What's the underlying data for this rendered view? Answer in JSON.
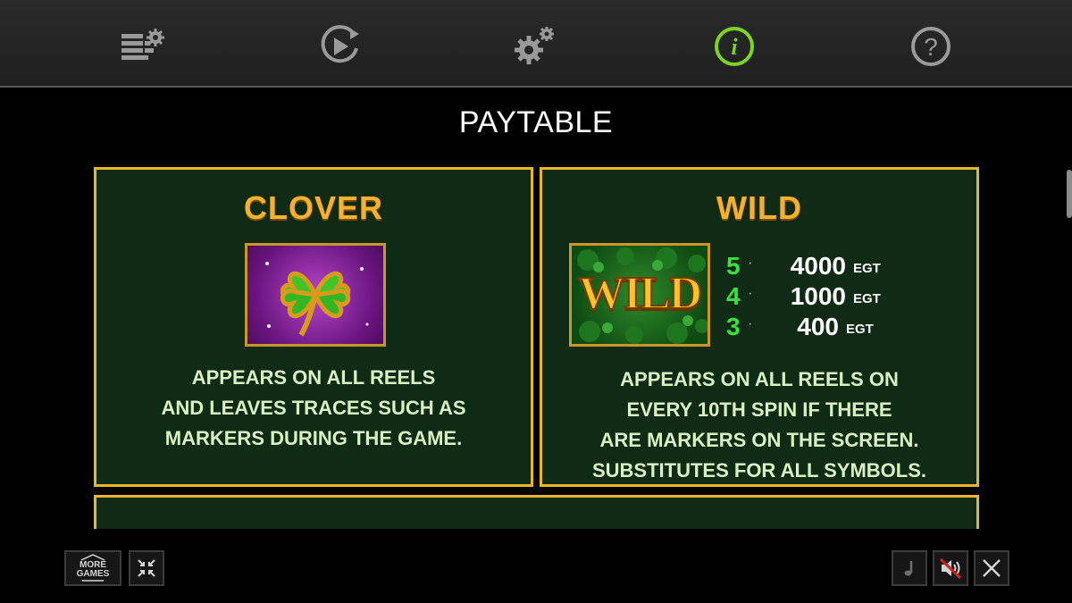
{
  "topnav": {
    "items": [
      {
        "name": "bet-settings"
      },
      {
        "name": "autoplay"
      },
      {
        "name": "settings"
      },
      {
        "name": "info",
        "active": true
      },
      {
        "name": "help"
      }
    ],
    "active_color": "#7ed321",
    "icon_color": "#9a9a9a"
  },
  "page": {
    "title": "PAYTABLE"
  },
  "clover": {
    "title": "CLOVER",
    "desc": [
      "APPEARS ON ALL REELS",
      "AND LEAVES TRACES SUCH AS",
      "MARKERS DURING THE GAME."
    ]
  },
  "wild": {
    "title": "WILD",
    "symbol_text": "WILD",
    "pays": [
      {
        "count": "5",
        "value": "4000",
        "unit": "EGT"
      },
      {
        "count": "4",
        "value": "1000",
        "unit": "EGT"
      },
      {
        "count": "3",
        "value": "400",
        "unit": "EGT"
      }
    ],
    "desc": [
      "APPEARS ON ALL REELS ON",
      "EVERY 10TH SPIN IF THERE",
      "ARE MARKERS ON THE SCREEN.",
      "SUBSTITUTES FOR ALL SYMBOLS."
    ]
  },
  "bottom": {
    "more_games": [
      "MORE",
      "GAMES"
    ]
  },
  "colors": {
    "panel_border": "#e8b52b",
    "panel_bg": "#0f2a15",
    "title_gold": "#f2b12f",
    "text_green": "#d8f2c2",
    "pay_green": "#39e23d"
  }
}
